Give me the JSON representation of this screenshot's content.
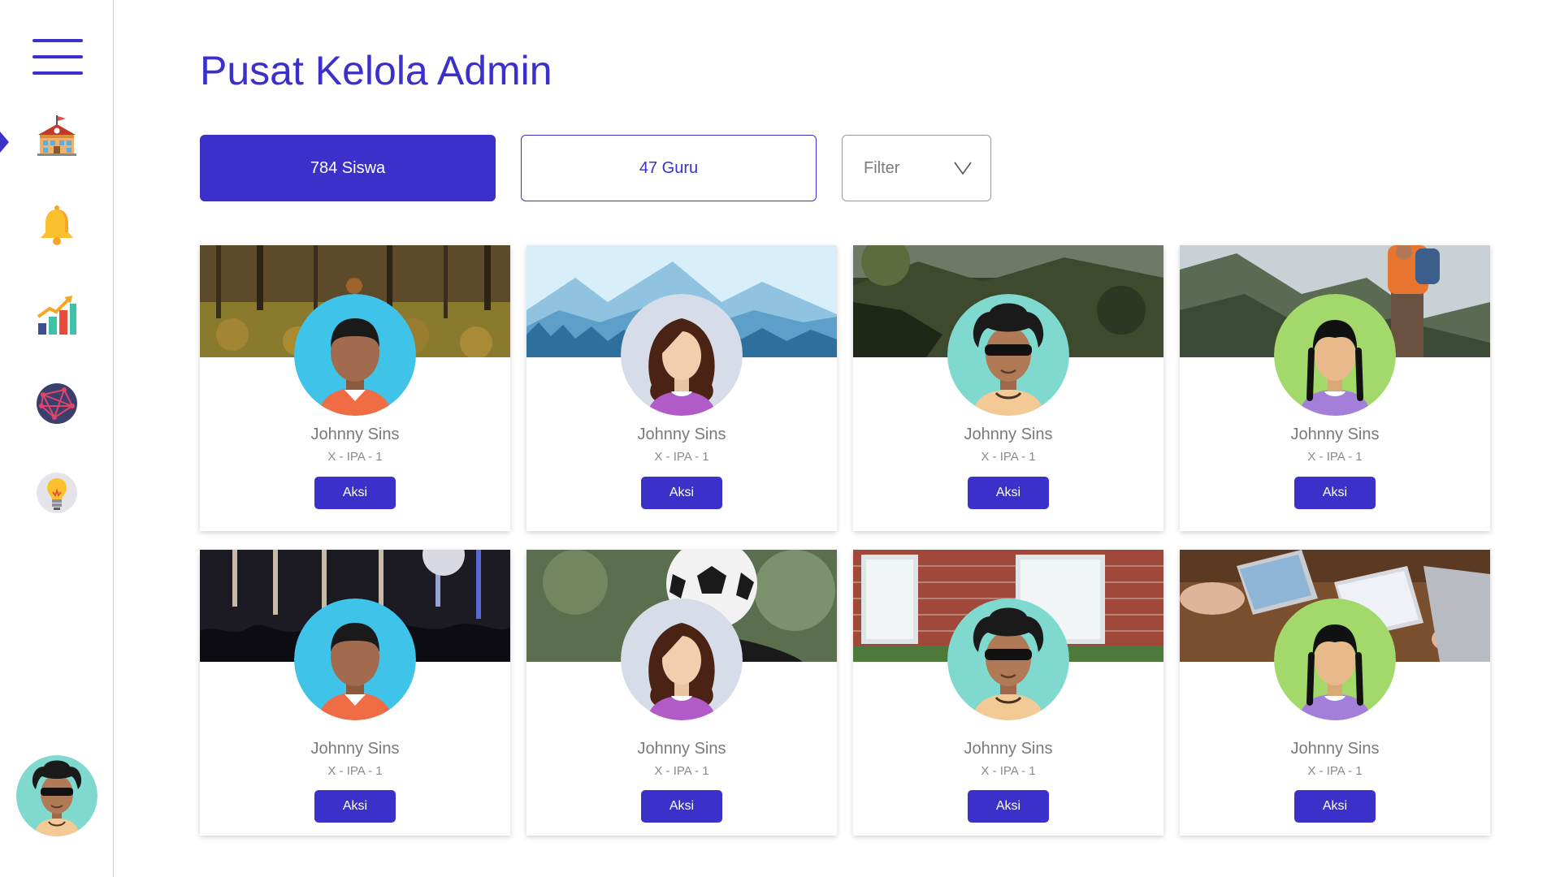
{
  "sidebar": {
    "items": [
      {
        "id": "school",
        "icon": "school-icon"
      },
      {
        "id": "notifications",
        "icon": "bell-icon"
      },
      {
        "id": "statistics",
        "icon": "chart-icon"
      },
      {
        "id": "network",
        "icon": "network-icon"
      },
      {
        "id": "ideas",
        "icon": "lightbulb-icon"
      }
    ],
    "active": "school"
  },
  "header": {
    "title": "Pusat Kelola Admin"
  },
  "tabs": {
    "students": "784 Siswa",
    "teachers": "47 Guru"
  },
  "filter": {
    "label": "Filter"
  },
  "cards": [
    {
      "name": "Johnny Sins",
      "class": "X - IPA - 1",
      "action": "Aksi",
      "banner": "forest",
      "avatar": "boy"
    },
    {
      "name": "Johnny Sins",
      "class": "X - IPA - 1",
      "action": "Aksi",
      "banner": "mountains",
      "avatar": "girl-long-hair"
    },
    {
      "name": "Johnny Sins",
      "class": "X - IPA - 1",
      "action": "Aksi",
      "banner": "hillside",
      "avatar": "curly-hair-sunglasses"
    },
    {
      "name": "Johnny Sins",
      "class": "X - IPA - 1",
      "action": "Aksi",
      "banner": "hiker",
      "avatar": "girl-braids"
    },
    {
      "name": "Johnny Sins",
      "class": "X - IPA - 1",
      "action": "Aksi",
      "banner": "concert",
      "avatar": "boy"
    },
    {
      "name": "Johnny Sins",
      "class": "X - IPA - 1",
      "action": "Aksi",
      "banner": "soccer-ball",
      "avatar": "girl-long-hair"
    },
    {
      "name": "Johnny Sins",
      "class": "X - IPA - 1",
      "action": "Aksi",
      "banner": "brick-building",
      "avatar": "curly-hair-sunglasses"
    },
    {
      "name": "Johnny Sins",
      "class": "X - IPA - 1",
      "action": "Aksi",
      "banner": "laptops",
      "avatar": "girl-braids"
    }
  ],
  "colors": {
    "accent": "#3b30c9",
    "text_muted": "#7a7a7a"
  }
}
